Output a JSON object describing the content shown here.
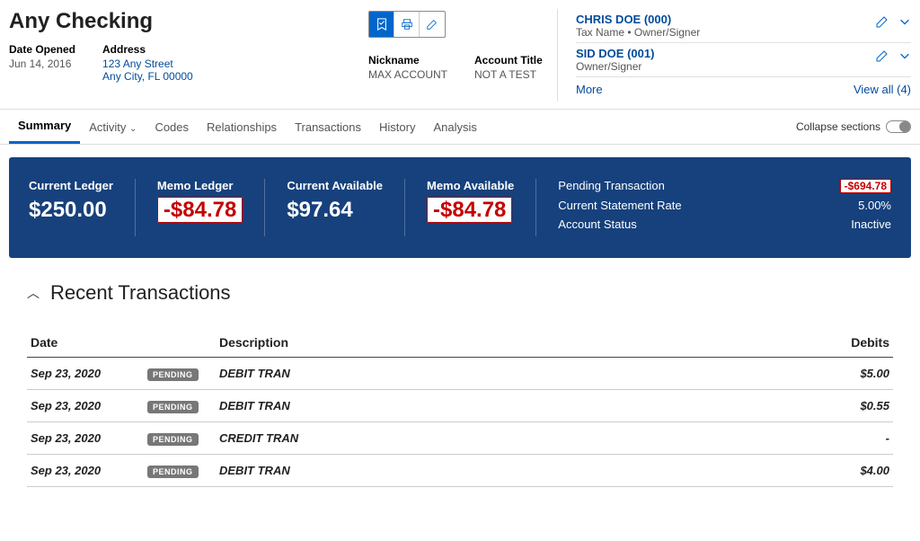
{
  "header": {
    "title": "Any Checking",
    "dateOpenedLabel": "Date Opened",
    "dateOpened": "Jun 14, 2016",
    "addressLabel": "Address",
    "address1": "123 Any Street",
    "address2": "Any City, FL 00000",
    "nicknameLabel": "Nickname",
    "nickname": "MAX ACCOUNT",
    "accountTitleLabel": "Account Title",
    "accountTitle": "NOT A TEST"
  },
  "people": [
    {
      "name": "CHRIS DOE (000)",
      "sub": "Tax Name • Owner/Signer"
    },
    {
      "name": "SID DOE (001)",
      "sub": "Owner/Signer"
    }
  ],
  "moreLabel": "More",
  "viewAllLabel": "View all (4)",
  "tabs": [
    "Summary",
    "Activity",
    "Codes",
    "Relationships",
    "Transactions",
    "History",
    "Analysis"
  ],
  "collapseLabel": "Collapse sections",
  "band": {
    "currentLedgerLabel": "Current Ledger",
    "currentLedger": "$250.00",
    "memoLedgerLabel": "Memo Ledger",
    "memoLedger": "-$84.78",
    "currentAvailLabel": "Current Available",
    "currentAvail": "$97.64",
    "memoAvailLabel": "Memo Available",
    "memoAvail": "-$84.78",
    "pendingLabel": "Pending Transaction",
    "pendingVal": "-$694.78",
    "rateLabel": "Current Statement Rate",
    "rateVal": "5.00%",
    "statusLabel": "Account Status",
    "statusVal": "Inactive"
  },
  "recent": {
    "title": "Recent Transactions",
    "cols": {
      "date": "Date",
      "desc": "Description",
      "debits": "Debits"
    },
    "rows": [
      {
        "date": "Sep 23, 2020",
        "badge": "PENDING",
        "desc": "DEBIT TRAN",
        "debit": "$5.00"
      },
      {
        "date": "Sep 23, 2020",
        "badge": "PENDING",
        "desc": "DEBIT TRAN",
        "debit": "$0.55"
      },
      {
        "date": "Sep 23, 2020",
        "badge": "PENDING",
        "desc": "CREDIT TRAN",
        "debit": "-"
      },
      {
        "date": "Sep 23, 2020",
        "badge": "PENDING",
        "desc": "DEBIT TRAN",
        "debit": "$4.00"
      }
    ]
  }
}
